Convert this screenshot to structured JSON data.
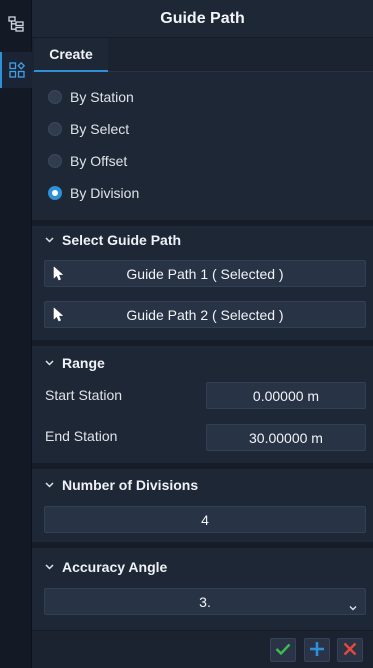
{
  "panel": {
    "title": "Guide Path",
    "tabs": [
      {
        "label": "Create",
        "active": true
      }
    ]
  },
  "rail": {
    "items": [
      {
        "icon": "tree-hierarchy-icon",
        "active": false
      },
      {
        "icon": "shapes-grid-icon",
        "active": true
      }
    ]
  },
  "method": {
    "options": [
      {
        "label": "By Station",
        "checked": false
      },
      {
        "label": "By Select",
        "checked": false
      },
      {
        "label": "By Offset",
        "checked": false
      },
      {
        "label": "By Division",
        "checked": true
      }
    ]
  },
  "select_guide_path": {
    "title": "Select Guide Path",
    "buttons": [
      {
        "label": "Guide Path 1 ( Selected )",
        "icon": "pointer-cursor-icon"
      },
      {
        "label": "Guide Path 2 ( Selected )",
        "icon": "pointer-cursor-icon"
      }
    ]
  },
  "range": {
    "title": "Range",
    "start_label": "Start Station",
    "start_value": "0.00000 m",
    "end_label": "End Station",
    "end_value": "30.00000 m"
  },
  "divisions": {
    "title": "Number of Divisions",
    "value": "4"
  },
  "accuracy": {
    "title": "Accuracy Angle",
    "value": "3."
  },
  "footer": {
    "buttons": [
      {
        "icon": "check-icon",
        "color": "#3fb950"
      },
      {
        "icon": "plus-icon",
        "color": "#2f8fd9"
      },
      {
        "icon": "close-icon",
        "color": "#e5483c"
      }
    ]
  },
  "colors": {
    "accent": "#2f8fd9",
    "background": "#1e2735",
    "field": "#283345"
  }
}
